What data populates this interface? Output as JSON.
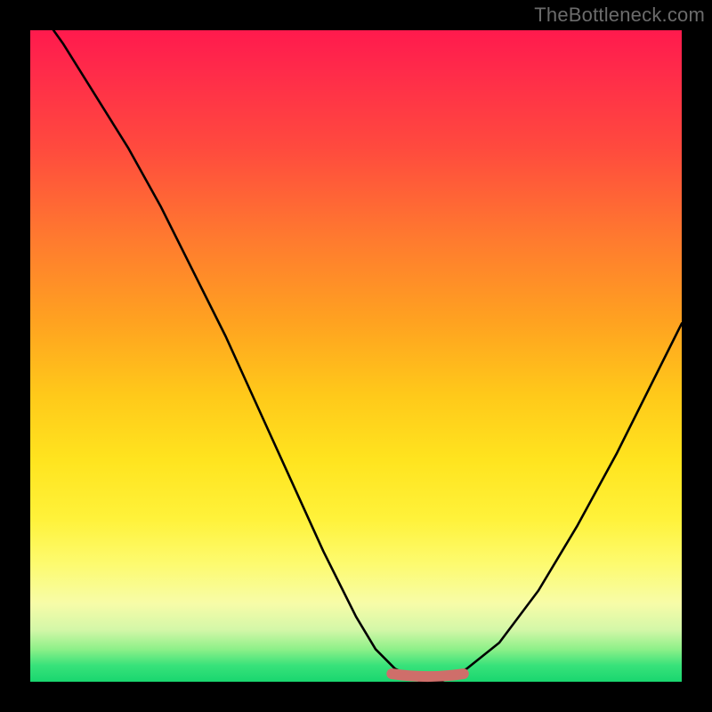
{
  "watermark": "TheBottleneck.com",
  "colors": {
    "frame": "#000000",
    "gradient_top": "#ff1a4d",
    "gradient_bottom": "#19d66f",
    "curve": "#000000",
    "flat_segment": "#cf6e6a"
  },
  "chart_data": {
    "type": "line",
    "title": "",
    "xlabel": "",
    "ylabel": "",
    "xlim": [
      0,
      1
    ],
    "ylim": [
      0,
      1
    ],
    "series": [
      {
        "name": "bottleneck-curve",
        "x": [
          0.0,
          0.05,
          0.1,
          0.15,
          0.2,
          0.25,
          0.3,
          0.35,
          0.4,
          0.45,
          0.5,
          0.53,
          0.56,
          0.6,
          0.63,
          0.67,
          0.72,
          0.78,
          0.84,
          0.9,
          0.95,
          1.0
        ],
        "values": [
          1.05,
          0.98,
          0.9,
          0.82,
          0.73,
          0.63,
          0.53,
          0.42,
          0.31,
          0.2,
          0.1,
          0.05,
          0.02,
          0.0,
          0.0,
          0.02,
          0.06,
          0.14,
          0.24,
          0.35,
          0.45,
          0.55
        ]
      }
    ],
    "flat_segment": {
      "x_start": 0.555,
      "x_end": 0.665,
      "y": 0.008
    }
  }
}
